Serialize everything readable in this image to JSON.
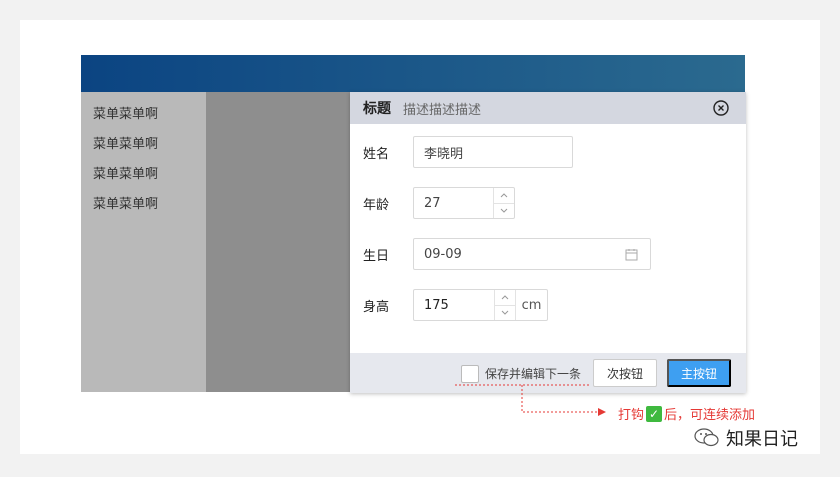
{
  "sidebar": {
    "items": [
      {
        "label": "菜单菜单啊"
      },
      {
        "label": "菜单菜单啊"
      },
      {
        "label": "菜单菜单啊"
      },
      {
        "label": "菜单菜单啊"
      }
    ]
  },
  "dialog": {
    "title": "标题",
    "description": "描述描述描述",
    "close_icon": "close-circle-icon",
    "fields": {
      "name": {
        "label": "姓名",
        "value": "李晓明"
      },
      "age": {
        "label": "年龄",
        "value": "27"
      },
      "birthday": {
        "label": "生日",
        "value": "09-09",
        "icon": "calendar-icon"
      },
      "height": {
        "label": "身高",
        "value": "175",
        "unit": "cm"
      }
    },
    "footer": {
      "checkbox_label": "保存并编辑下一条",
      "checkbox_checked": false,
      "secondary_button": "次按钮",
      "primary_button": "主按钮"
    }
  },
  "annotation": {
    "before": "打钩",
    "check_glyph": "✓",
    "after": "后，可连续添加",
    "color": "#e53935"
  },
  "watermark": {
    "text": "知果日记"
  },
  "colors": {
    "primary": "#3e9ff1",
    "header_gradient_start": "#0b4482",
    "header_gradient_end": "#2b6a8f"
  }
}
